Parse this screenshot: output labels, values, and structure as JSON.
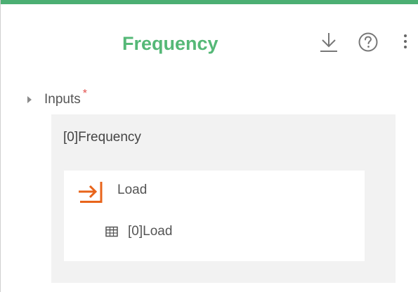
{
  "colors": {
    "accent": "#4caf73",
    "title": "#55b877",
    "required": "#e3504d",
    "load_icon": "#e8641b",
    "panel_bg": "#f2f2f2"
  },
  "header": {
    "title": "Frequency",
    "icons": [
      "download-icon",
      "help-icon",
      "more-vertical-icon"
    ]
  },
  "inputs": {
    "label": "Inputs",
    "required_marker": "*",
    "expanded": true,
    "items": [
      {
        "name": "[0]Frequency",
        "source": {
          "icon": "input-arrow-icon",
          "label": "Load",
          "table_icon": "table-icon",
          "item": "[0]Load"
        }
      }
    ]
  }
}
